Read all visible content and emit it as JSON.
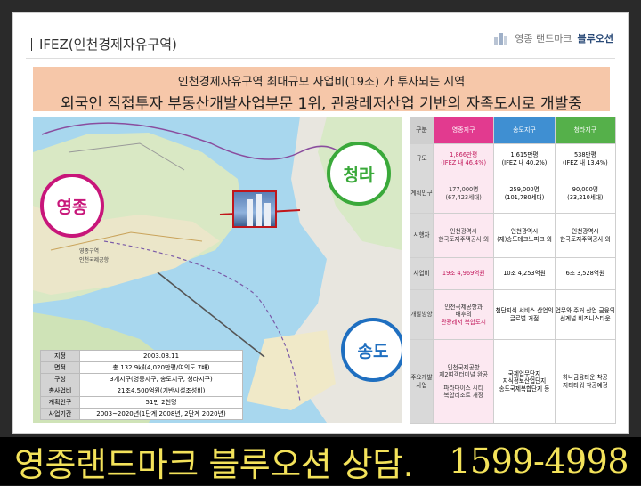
{
  "header": {
    "title": "IFEZ(인천경제자유구역)",
    "logo_prefix": "영종 랜드마크",
    "logo_brand": "블루오션"
  },
  "banner": {
    "line1": "인천경제자유구역 최대규모 사업비(19조) 가 투자되는 지역",
    "line2": "외국인 직접투자 부동산개발사업부문 1위, 관광레저산업 기반의 자족도시로 개발중"
  },
  "map": {
    "circles": {
      "yeongjong": "영종",
      "cheongna": "청라",
      "songdo": "송도"
    },
    "labels": [
      "영종구역",
      "인천국제공항"
    ],
    "info": [
      {
        "k": "지정",
        "v": "2003.08.11"
      },
      {
        "k": "면적",
        "v": "총 132.9㎢(4,020만평/여의도 7배)"
      },
      {
        "k": "구성",
        "v": "3개지구(영종지구, 송도지구, 청라지구)"
      },
      {
        "k": "총사업비",
        "v": "21조4,500억원(기반시설조성비)"
      },
      {
        "k": "계획인구",
        "v": "51만 2천명"
      },
      {
        "k": "사업기간",
        "v": "2003~2020년(1단계 2008년, 2단계 2020년)"
      }
    ]
  },
  "table": {
    "corner": "구분",
    "columns": [
      "영종지구",
      "송도지구",
      "청라지구"
    ],
    "rows": [
      {
        "label": "규모",
        "cells": [
          [
            "1,866만평",
            "(IFEZ 내 46.4%)"
          ],
          [
            "1,615만평",
            "(IFEZ 내 40.2%)"
          ],
          [
            "538만평",
            "(IFEZ 내 13.4%)"
          ]
        ]
      },
      {
        "label": "계획인구",
        "cells": [
          [
            "177,000명",
            "(67,423세대)"
          ],
          [
            "259,000명",
            "(101,780세대)"
          ],
          [
            "90,000명",
            "(33,210세대)"
          ]
        ]
      },
      {
        "label": "시행자",
        "cells": [
          [
            "인천광역시",
            "한국토지주택공사 외"
          ],
          [
            "인천광역시",
            "(재)송도테크노파크 외"
          ],
          [
            "인천광역시",
            "한국토지주택공사 외"
          ]
        ]
      },
      {
        "label": "사업비",
        "cells": [
          [
            "19조 4,969억원"
          ],
          [
            "10조 4,253억원"
          ],
          [
            "6조 3,528억원"
          ]
        ]
      },
      {
        "label": "개발방향",
        "cells": [
          [
            "인천국제공항과",
            "배후의",
            "관광레저 복합도시"
          ],
          [
            "첨단지식 서비스 산업의",
            "글로벌 거점"
          ],
          [
            "업무와 주거 산업 금융의",
            "선계널 비즈니스타운"
          ]
        ]
      },
      {
        "label": "주요개발사업",
        "cells": [
          [
            "인천국제공항",
            "제2여객터미널 완공",
            "",
            "파라다이스 시티",
            "복합리조트 개장"
          ],
          [
            "국제업무단지",
            "지식정보산업단지",
            "송도국제복합단지 등"
          ],
          [
            "하나금융타운 착공",
            "지티타워 착공예정"
          ]
        ]
      }
    ]
  },
  "footer": {
    "text": "영종랜드마크 블루오션 상담.",
    "phone": "1599-4998"
  }
}
